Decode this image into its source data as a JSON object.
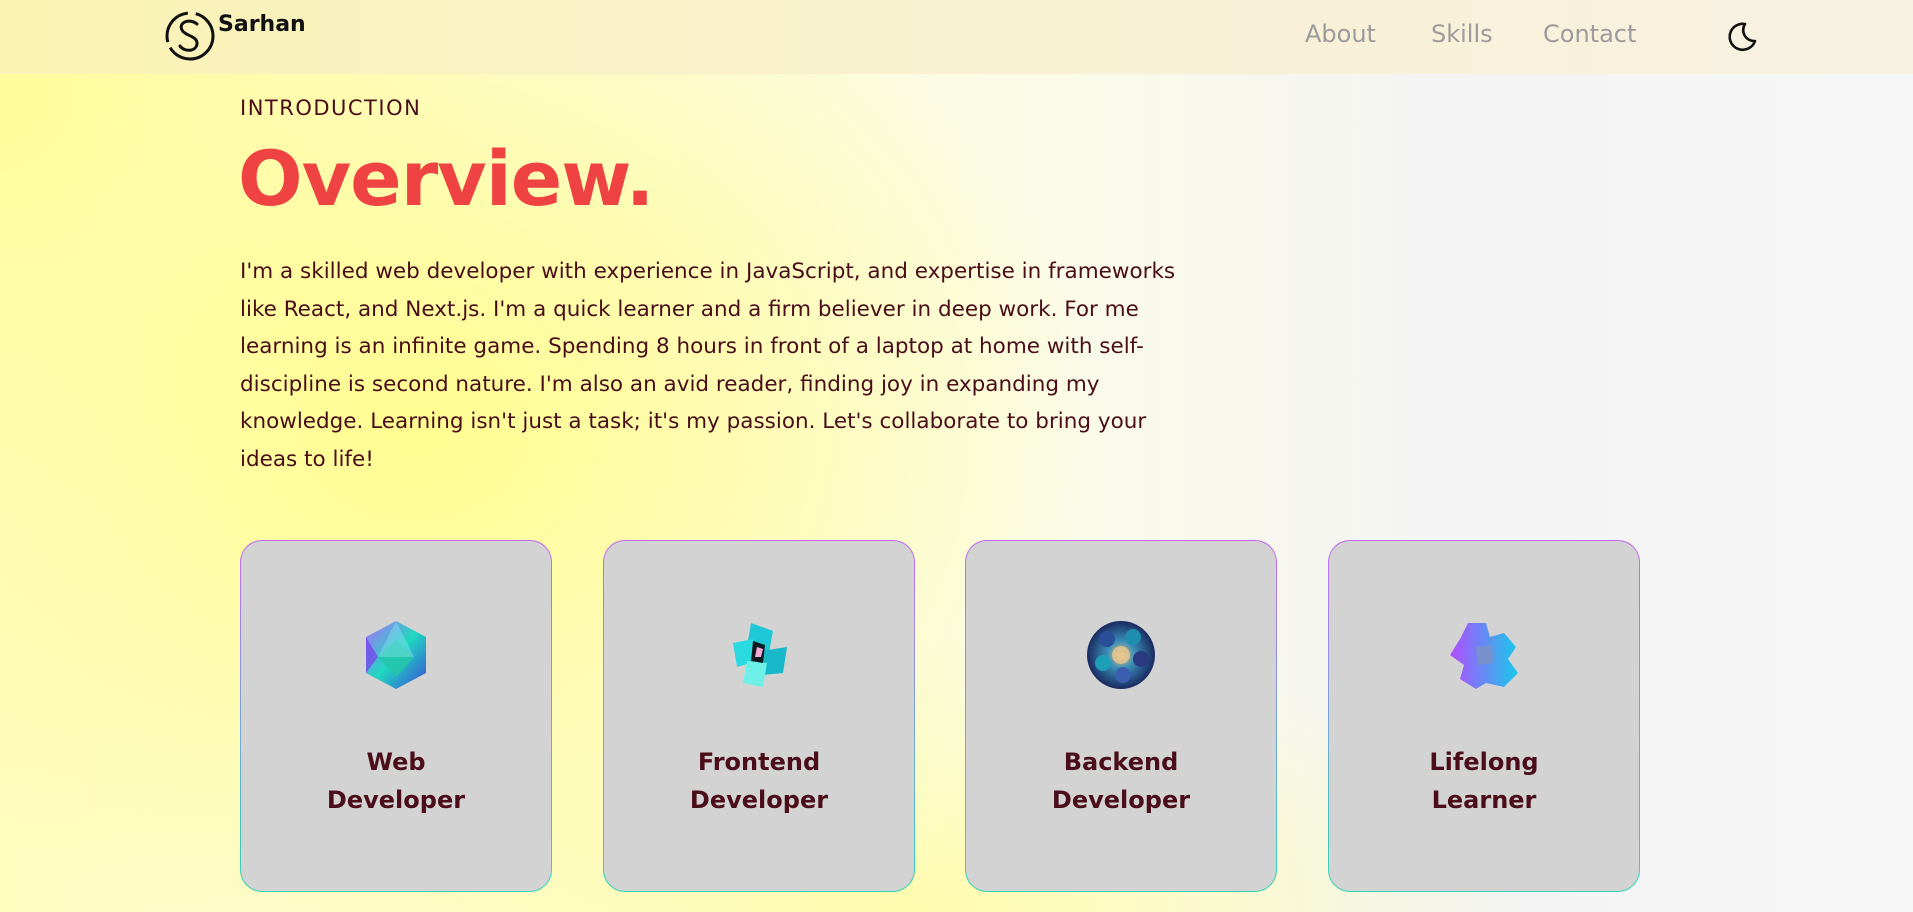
{
  "brand": {
    "name": "Sarhan",
    "logo_icon": "s-monogram-icon"
  },
  "nav": {
    "links": [
      "About",
      "Skills",
      "Contact"
    ],
    "theme_toggle_icon": "moon-icon"
  },
  "intro": {
    "label": "INTRODUCTION",
    "title": "Overview.",
    "paragraph": "I'm a skilled web developer with experience in JavaScript, and expertise in frameworks like React, and Next.js. I'm a quick learner and a firm believer in deep work. For me learning is an infinite game. Spending 8 hours in front of a laptop at home with self-discipline is second nature. I'm also an avid reader, finding joy in expanding my knowledge. Learning isn't just a task; it's my passion. Let's collaborate to bring your ideas to life!"
  },
  "cards": [
    {
      "line1": "Web",
      "line2": "Developer",
      "icon": "icosahedron-icon"
    },
    {
      "line1": "Frontend",
      "line2": "Developer",
      "icon": "cube-cluster-icon"
    },
    {
      "line1": "Backend",
      "line2": "Developer",
      "icon": "sphere-cluster-icon"
    },
    {
      "line1": "Lifelong",
      "line2": "Learner",
      "icon": "cross-blocks-icon"
    }
  ],
  "colors": {
    "accent": "#ef4242",
    "text": "#4a0d19",
    "card_bg": "#d3d3d3",
    "nav_text": "#9b9b9b"
  }
}
